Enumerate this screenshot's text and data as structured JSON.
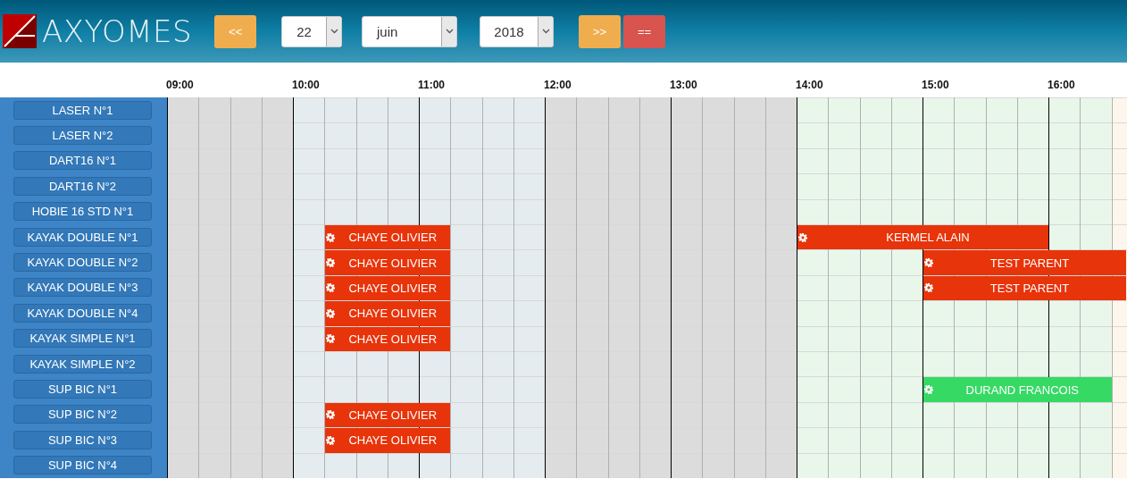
{
  "header": {
    "logo": "AXYOMES",
    "prev": "<<",
    "day": "22",
    "month": "juin",
    "year": "2018",
    "next": ">>",
    "today": "=="
  },
  "hours": [
    "09:00",
    "10:00",
    "11:00",
    "12:00",
    "13:00",
    "14:00",
    "15:00",
    "16:00"
  ],
  "resources": [
    {
      "name": "LASER N°1"
    },
    {
      "name": "LASER N°2"
    },
    {
      "name": "DART16 N°1"
    },
    {
      "name": "DART16 N°2"
    },
    {
      "name": "HOBIE 16 STD N°1"
    },
    {
      "name": "KAYAK DOUBLE N°1",
      "events": [
        {
          "name": "CHAYE OLIVIER",
          "color": "#e8340a"
        },
        {
          "name": "KERMEL ALAIN",
          "color": "#e8340a"
        }
      ]
    },
    {
      "name": "KAYAK DOUBLE N°2",
      "events": [
        {
          "name": "CHAYE OLIVIER",
          "color": "#e8340a"
        },
        {
          "name": "TEST PARENT",
          "color": "#e8340a"
        }
      ]
    },
    {
      "name": "KAYAK DOUBLE N°3",
      "events": [
        {
          "name": "CHAYE OLIVIER",
          "color": "#e8340a"
        },
        {
          "name": "TEST PARENT",
          "color": "#e8340a"
        }
      ]
    },
    {
      "name": "KAYAK DOUBLE N°4",
      "events": [
        {
          "name": "CHAYE OLIVIER",
          "color": "#e8340a"
        }
      ]
    },
    {
      "name": "KAYAK SIMPLE N°1",
      "events": [
        {
          "name": "CHAYE OLIVIER",
          "color": "#e8340a"
        }
      ]
    },
    {
      "name": "KAYAK SIMPLE N°2"
    },
    {
      "name": "SUP BIC N°1",
      "events": [
        {
          "name": "DURAND FRANCOIS",
          "color": "#36d964"
        }
      ]
    },
    {
      "name": "SUP BIC N°2",
      "events": [
        {
          "name": "CHAYE OLIVIER",
          "color": "#e8340a"
        }
      ]
    },
    {
      "name": "SUP BIC N°3",
      "events": [
        {
          "name": "CHAYE OLIVIER",
          "color": "#e8340a"
        }
      ]
    },
    {
      "name": "SUP BIC N°4"
    }
  ]
}
